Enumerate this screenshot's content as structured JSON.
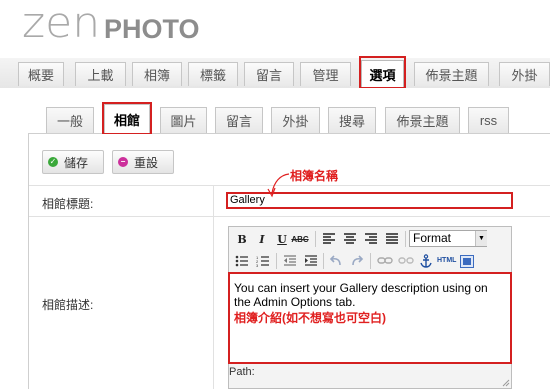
{
  "logo": {
    "zen": "zen",
    "photo": "PHOTO"
  },
  "main_tabs": [
    {
      "label": "概要"
    },
    {
      "label": "上載"
    },
    {
      "label": "相簿"
    },
    {
      "label": "標籤"
    },
    {
      "label": "留言"
    },
    {
      "label": "管理"
    },
    {
      "label": "選項",
      "active": true
    },
    {
      "label": "佈景主題"
    },
    {
      "label": "外掛"
    }
  ],
  "sub_tabs": [
    {
      "label": "一般"
    },
    {
      "label": "相館",
      "active": true
    },
    {
      "label": "圖片"
    },
    {
      "label": "留言"
    },
    {
      "label": "外掛"
    },
    {
      "label": "搜尋"
    },
    {
      "label": "佈景主題"
    },
    {
      "label": "rss"
    }
  ],
  "buttons": {
    "save": "儲存",
    "reset": "重設"
  },
  "form": {
    "gallery_title_label": "相館標題:",
    "gallery_title_value": "Gallery",
    "gallery_title_annotation": "相簿名稱",
    "gallery_desc_label": "相館描述:"
  },
  "editor": {
    "format_label": "Format",
    "html_label": "HTML",
    "content": "You can insert your Gallery description using on the Admin Options tab.",
    "annotation": "相簿介紹(如不想寫也可空白)",
    "path_label": "Path:"
  },
  "colors": {
    "highlight": "#d42020",
    "annotation": "#e02020",
    "save_icon": "#3aa83a",
    "reset_icon": "#cc2f9b"
  }
}
